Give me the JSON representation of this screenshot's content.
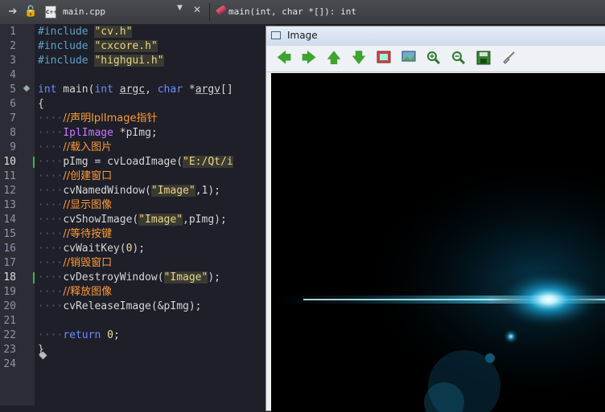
{
  "editor": {
    "file_name": "main.cpp",
    "symbol": "main(int, char *[]): int",
    "line_numbers": [
      "1",
      "2",
      "3",
      "4",
      "5",
      "6",
      "7",
      "8",
      "9",
      "10",
      "11",
      "12",
      "13",
      "14",
      "15",
      "16",
      "17",
      "18",
      "19",
      "20",
      "21",
      "22",
      "23",
      "24"
    ]
  },
  "code": {
    "include_kw": "#include",
    "inc1": "\"cv.h\"",
    "inc2": "\"cxcore.h\"",
    "inc3": "\"highgui.h\"",
    "int_kw": "int",
    "main_name": " main(",
    "int_kw2": "int",
    "argc": "argc",
    "comma": ", ",
    "char_kw": "char",
    "star": " *",
    "argv": "argv",
    "bracket": "[]",
    "open_brace": "{",
    "c1": "//声明IplImage指针",
    "ipl_type": "IplImage",
    "pimg_decl": " *pImg;",
    "c2": "//载入图片",
    "load_call": "pImg = cvLoadImage(",
    "load_path": "\"E:/Qt/i",
    "c3": "//创建窗口",
    "named_call": "cvNamedWindow(",
    "image_str": "\"Image\"",
    "named_end": ",1);",
    "c4": "//显示图像",
    "show_call": "cvShowImage(",
    "show_end": ",pImg);",
    "c5": "//等待按键",
    "wait_call": "cvWaitKey(",
    "zero": "0",
    "wait_end": ");",
    "c6": "//销毁窗口",
    "destroy_call": "cvDestroyWindow(",
    "destroy_end": ");",
    "c7": "//释放图像",
    "release_call": "cvReleaseImage(&pImg);",
    "return_kw": "return",
    "return_end": ";",
    "close_brace": "}"
  },
  "image_window": {
    "title": "Image"
  },
  "icons": [
    "back-arrow-icon",
    "forward-arrow-icon",
    "up-arrow-icon",
    "down-arrow-icon",
    "image-fit-icon",
    "image-view-icon",
    "zoom-in-icon",
    "zoom-out-icon",
    "save-icon",
    "brush-icon"
  ],
  "colors": {
    "editor_bg": "#1e1f29",
    "comment": "#ff9a33",
    "keyword": "#6f8cff",
    "string": "#e8d48a"
  }
}
